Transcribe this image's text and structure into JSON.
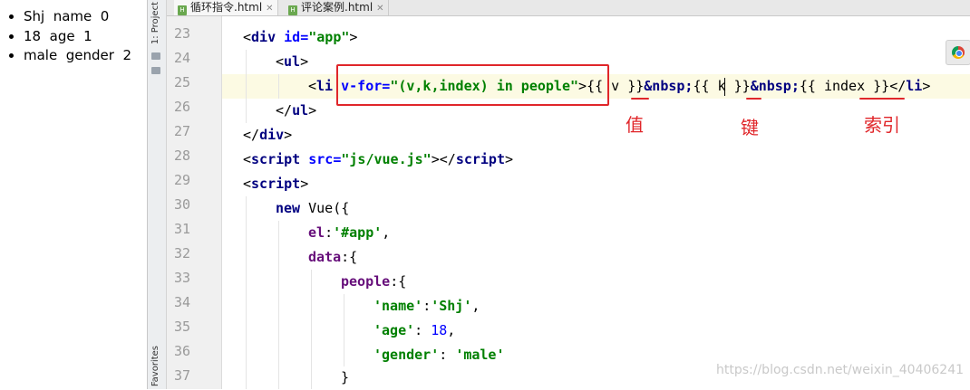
{
  "preview": {
    "items": [
      "Shj  name  0",
      "18  age  1",
      "male  gender  2"
    ]
  },
  "tool_window": {
    "project_label": "1: Project",
    "favorites_label": "Favorites"
  },
  "tabs": [
    {
      "label": "循环指令.html",
      "icon": "html-file-icon"
    },
    {
      "label": "评论案例.html",
      "icon": "html-file-icon"
    }
  ],
  "line_numbers": [
    "23",
    "24",
    "25",
    "26",
    "27",
    "28",
    "29",
    "30",
    "31",
    "32",
    "33",
    "34",
    "35",
    "36",
    "37"
  ],
  "code": {
    "l23": {
      "open": "<",
      "tag": "div",
      "attr": " id=",
      "val": "\"app\"",
      "close": ">"
    },
    "l24": {
      "open": "<",
      "tag": "ul",
      "close": ">"
    },
    "l25": {
      "open": "<",
      "tag": "li",
      "vfor": " v-for=",
      "vfor_val": "\"(v,k,index) in people\"",
      "close": ">",
      "m1": "{{ v }}",
      "nbsp1": "&nbsp;",
      "m2": "{{ k }}",
      "nbsp2": "&nbsp;",
      "m3": "{{ index }}",
      "end_open": "</",
      "end_tag": "li",
      "end_close": ">"
    },
    "l26": {
      "open": "</",
      "tag": "ul",
      "close": ">"
    },
    "l27": {
      "open": "</",
      "tag": "div",
      "close": ">"
    },
    "l28": {
      "open": "<",
      "tag": "script",
      "attr": " src=",
      "val": "\"js/vue.js\"",
      "close": ">",
      "end_open": "</",
      "end_tag": "script",
      "end_close": ">"
    },
    "l29": {
      "open": "<",
      "tag": "script",
      "close": ">"
    },
    "l30": {
      "kw": "new",
      "rest": " Vue({"
    },
    "l31": {
      "key": "el",
      "colon": ":",
      "val": "'#app'",
      "tail": ","
    },
    "l32": {
      "key": "data",
      "rest": ":{"
    },
    "l33": {
      "key": "people",
      "rest": ":{"
    },
    "l34": {
      "key": "'name'",
      "colon": ":",
      "val": "'Shj'",
      "tail": ","
    },
    "l35": {
      "key": "'age'",
      "colon": ": ",
      "num": "18",
      "tail": ","
    },
    "l36": {
      "key": "'gender'",
      "colon": ": ",
      "val": "'male'"
    },
    "l37": {
      "text": "}"
    }
  },
  "annotations": {
    "value_label": "值",
    "key_label": "键",
    "index_label": "索引",
    "accent_color": "#e0262a"
  },
  "watermark": "https://blog.csdn.net/weixin_40406241",
  "colors": {
    "tag": "#000080",
    "attribute": "#0000ff",
    "string": "#008000",
    "current_line": "#fcfae3"
  }
}
